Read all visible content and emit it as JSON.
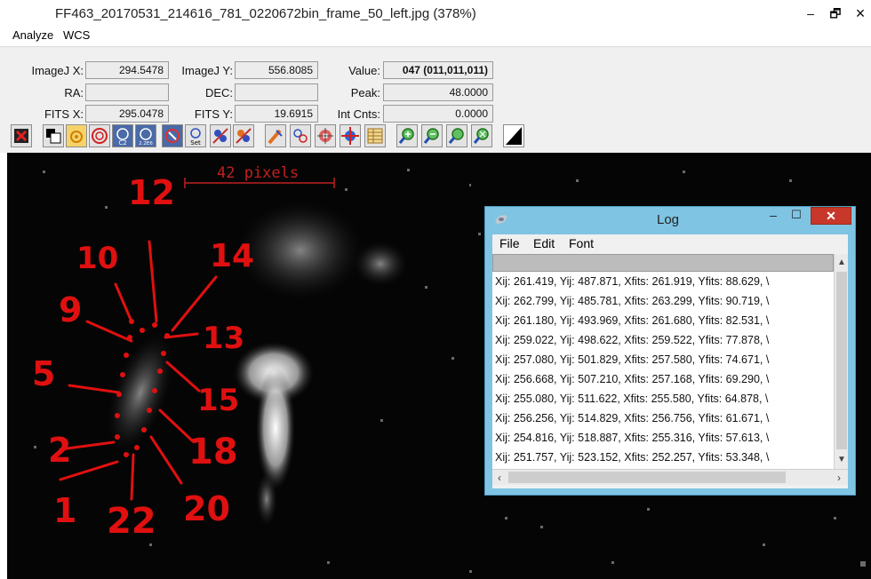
{
  "window": {
    "title": "FF463_20170531_214616_781_0220672bin_frame_50_left.jpg (378%)",
    "minimize": "–",
    "maximize": "🗗",
    "close": "×"
  },
  "menu": {
    "analyze": "Analyze",
    "wcs": "WCS"
  },
  "info": {
    "imagej_x_label": "ImageJ X:",
    "imagej_x": "294.5478",
    "imagej_y_label": "ImageJ Y:",
    "imagej_y": "556.8085",
    "value_label": "Value:",
    "value": "047 (011,011,011)",
    "ra_label": "RA:",
    "ra": "",
    "dec_label": "DEC:",
    "dec": "",
    "peak_label": "Peak:",
    "peak": "48.0000",
    "fits_x_label": "FITS X:",
    "fits_x": "295.0478",
    "fits_y_label": "FITS Y:",
    "fits_y": "19.6915",
    "int_cnts_label": "Int Cnts:",
    "int_cnts": "0.0000"
  },
  "toolbar": {
    "icons": [
      "close-image-icon",
      "toggle-inverted-icon",
      "aperture-color-icon",
      "aperture-circle-icon",
      "centroid-c2-icon",
      "zoom-2x2e6-icon",
      "aperture-options-icon",
      "set-aperture-icon",
      "measure-multi-icon",
      "measure-tools-icon",
      "clear-overlay-icon",
      "show-apertures-icon",
      "annotate-star-icon",
      "astrometry-target-icon",
      "table-icon",
      "zoom-in-icon",
      "zoom-out-icon",
      "zoom-fit-icon",
      "zoom-full-icon",
      "contrast-icon"
    ],
    "c2_text": "C2",
    "zoom_text": "2.2E6",
    "set_text": "Set",
    "scale_text": "S10E"
  },
  "image": {
    "scale_label": "42 pixels",
    "annotation_color": "#e01010",
    "annotations": [
      "12",
      "10",
      "14",
      "9",
      "13",
      "5",
      "15",
      "2",
      "18",
      "1",
      "22",
      "20"
    ]
  },
  "log": {
    "title": "Log",
    "menu": [
      "File",
      "Edit",
      "Font"
    ],
    "lines": [
      "Xij: 261.419,  Yij: 487.871,  Xfits: 261.919,  Yfits: 88.629,  \\",
      "Xij: 262.799,  Yij: 485.781,  Xfits: 263.299,  Yfits: 90.719,  \\",
      "Xij: 261.180,  Yij: 493.969,  Xfits: 261.680,  Yfits: 82.531,  \\",
      "Xij: 259.022,  Yij: 498.622,  Xfits: 259.522,  Yfits: 77.878,  \\",
      "Xij: 257.080,  Yij: 501.829,  Xfits: 257.580,  Yfits: 74.671,  \\",
      "Xij: 256.668,  Yij: 507.210,  Xfits: 257.168,  Yfits: 69.290,  \\",
      "Xij: 255.080,  Yij: 511.622,  Xfits: 255.580,  Yfits: 64.878,  \\",
      "Xij: 256.256,  Yij: 514.829,  Xfits: 256.756,  Yfits: 61.671,  \\",
      "Xij: 254.816,  Yij: 518.887,  Xfits: 255.316,  Yfits: 57.613,  \\",
      "Xij: 251.757,  Yij: 523.152,  Xfits: 252.257,  Yfits: 53.348,  \\"
    ],
    "minimize": "–",
    "maximize": "☐",
    "close": "✕"
  }
}
